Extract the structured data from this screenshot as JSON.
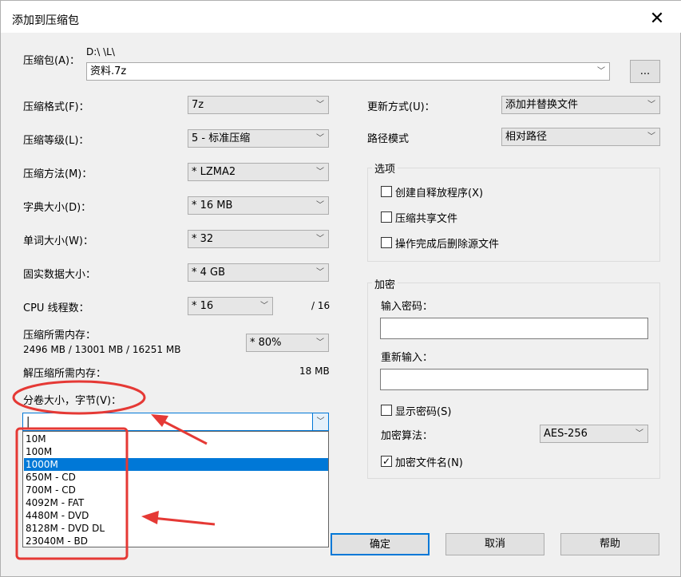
{
  "window": {
    "title": "添加到压缩包",
    "close": "✕"
  },
  "archive": {
    "label": "压缩包(A)：",
    "path": "D:\\                  \\L\\",
    "filename": "资料.7z",
    "browse": "..."
  },
  "left": {
    "format": {
      "label": "压缩格式(F)：",
      "value": "7z"
    },
    "level": {
      "label": "压缩等级(L)：",
      "value": "5 - 标准压缩"
    },
    "method": {
      "label": "压缩方法(M)：",
      "value": "* LZMA2"
    },
    "dict": {
      "label": "字典大小(D)：",
      "value": "* 16 MB"
    },
    "word": {
      "label": "单词大小(W)：",
      "value": "* 32"
    },
    "solid": {
      "label": "固实数据大小：",
      "value": "* 4 GB"
    },
    "threads": {
      "label": "CPU 线程数：",
      "value": "* 16",
      "max": "/ 16"
    },
    "memcomp": {
      "label": "压缩所需内存：",
      "detail": "2496 MB / 13001 MB / 16251 MB",
      "value": "* 80%"
    },
    "memdecomp": {
      "label": "解压缩所需内存：",
      "value": "18 MB"
    },
    "split": {
      "label": "分卷大小，字节(V)：",
      "value": "|"
    }
  },
  "dropdown": {
    "options": [
      "10M",
      "100M",
      "1000M",
      "650M - CD",
      "700M - CD",
      "4092M - FAT",
      "4480M - DVD",
      "8128M - DVD DL",
      "23040M - BD"
    ],
    "selected": 2
  },
  "right": {
    "update": {
      "label": "更新方式(U)：",
      "value": "添加并替换文件"
    },
    "pathmode": {
      "label": "路径模式",
      "value": "相对路径"
    },
    "options": {
      "title": "选项",
      "items": [
        {
          "label": "创建自释放程序(X)",
          "checked": false
        },
        {
          "label": "压缩共享文件",
          "checked": false
        },
        {
          "label": "操作完成后删除源文件",
          "checked": false
        }
      ]
    },
    "encrypt": {
      "title": "加密",
      "pwd_label": "输入密码：",
      "repwd_label": "重新输入：",
      "show_pwd": "显示密码(S)",
      "algo_label": "加密算法：",
      "algo_value": "AES-256",
      "encnames": "加密文件名(N)",
      "encnames_mark": "✓"
    }
  },
  "buttons": {
    "ok": "确定",
    "cancel": "取消",
    "help": "帮助"
  },
  "colors": {
    "selection": "#0078d7",
    "annotation": "#e53935"
  }
}
